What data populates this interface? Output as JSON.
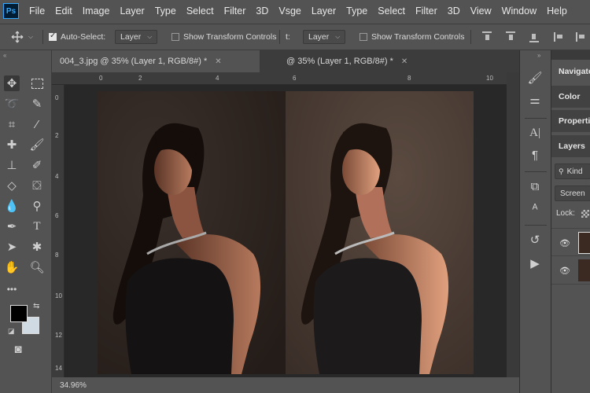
{
  "app": {
    "logo": "Ps"
  },
  "menu": [
    "File",
    "Edit",
    "Image",
    "Layer",
    "Type",
    "Select",
    "Filter",
    "3D",
    "Vsge",
    "Layer",
    "Type",
    "Select",
    "Filter",
    "3D",
    "View",
    "Window",
    "Help"
  ],
  "options": {
    "auto_select_label": "Auto-Select:",
    "auto_select_checked": true,
    "layer_dropdown": "Layer",
    "show_transform": "Show Transform Controls",
    "fragment": "t:",
    "layer_dropdown2": "Layer",
    "show_transform2": "Show Transform Controls"
  },
  "tabs": [
    {
      "label": "004_3.jpg @ 35% (Layer 1, RGB/8#) *",
      "close": "✕",
      "active": true
    },
    {
      "label": "@ 35% (Layer 1, RGB/8#) *",
      "close": "✕",
      "active": false
    }
  ],
  "ruler_top": [
    "0",
    "2",
    "4",
    "6",
    "8",
    "10"
  ],
  "ruler_left": [
    "0",
    "2",
    "4",
    "6",
    "8",
    "10",
    "12",
    "14"
  ],
  "status": {
    "zoom": "34.96%"
  },
  "colors": {
    "foreground": "#000000",
    "background": "#cfdae3"
  },
  "panels": {
    "navigator": "Navigato",
    "color": "Color",
    "properties": "Propertie",
    "layers": "Layers",
    "kind": "Kind",
    "blend": "Screen",
    "lock": "Lock:"
  }
}
